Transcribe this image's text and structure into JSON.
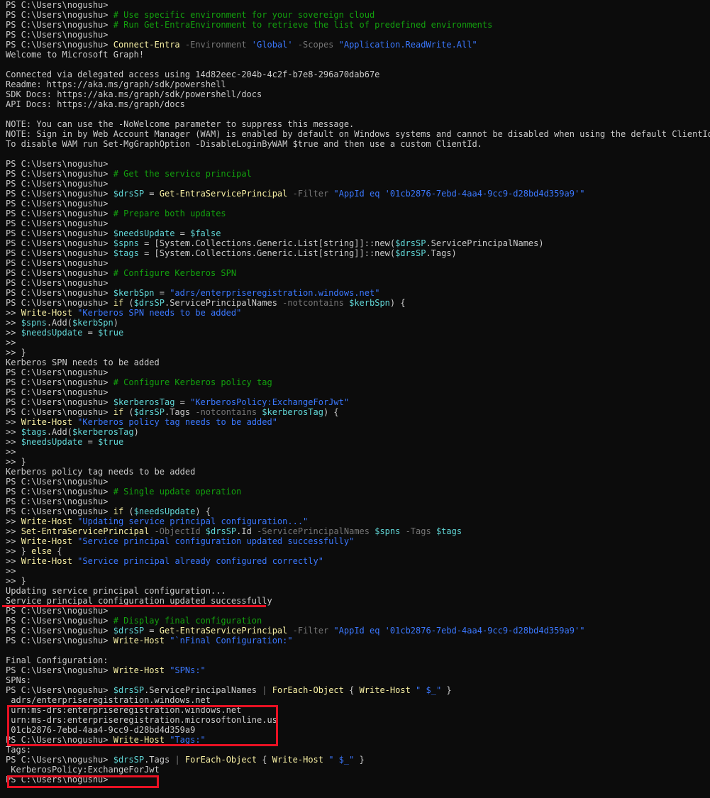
{
  "window": {
    "background": "#0c0c0c",
    "foreground": "#cccccc"
  },
  "colors": {
    "prompt": "#cccccc",
    "comment": "#13a10e",
    "command": "#f9f1a5",
    "variable": "#61d6d6",
    "string": "#3b78ff",
    "parameter": "#767676",
    "annotation": "#e81123"
  },
  "terminal": {
    "lines": [
      [
        [
          "p",
          "PS C:\\Users\\nogushu> "
        ]
      ],
      [
        [
          "p",
          "PS C:\\Users\\nogushu> "
        ],
        [
          "c",
          "# Use specific environment for your sovereign cloud"
        ]
      ],
      [
        [
          "p",
          "PS C:\\Users\\nogushu> "
        ],
        [
          "c",
          "# Run Get-EntraEnvironment to retrieve the list of predefined environments"
        ]
      ],
      [
        [
          "p",
          "PS C:\\Users\\nogushu> "
        ]
      ],
      [
        [
          "p",
          "PS C:\\Users\\nogushu> "
        ],
        [
          "k",
          "Connect-Entra"
        ],
        [
          "a",
          " -Environment "
        ],
        [
          "s",
          "'Global'"
        ],
        [
          "a",
          " -Scopes "
        ],
        [
          "s",
          "\"Application.ReadWrite.All\""
        ]
      ],
      [
        [
          "t",
          "Welcome to Microsoft Graph!"
        ]
      ],
      [
        [
          "t",
          ""
        ]
      ],
      [
        [
          "t",
          "Connected via delegated access using 14d82eec-204b-4c2f-b7e8-296a70dab67e"
        ]
      ],
      [
        [
          "t",
          "Readme: https://aka.ms/graph/sdk/powershell"
        ]
      ],
      [
        [
          "t",
          "SDK Docs: https://aka.ms/graph/sdk/powershell/docs"
        ]
      ],
      [
        [
          "t",
          "API Docs: https://aka.ms/graph/docs"
        ]
      ],
      [
        [
          "t",
          ""
        ]
      ],
      [
        [
          "t",
          "NOTE: You can use the -NoWelcome parameter to suppress this message."
        ]
      ],
      [
        [
          "t",
          "NOTE: Sign in by Web Account Manager (WAM) is enabled by default on Windows systems and cannot be disabled when using the default ClientId."
        ]
      ],
      [
        [
          "t",
          "To disable WAM run Set-MgGraphOption -DisableLoginByWAM $true and then use a custom ClientId."
        ]
      ],
      [
        [
          "t",
          ""
        ]
      ],
      [
        [
          "p",
          "PS C:\\Users\\nogushu> "
        ]
      ],
      [
        [
          "p",
          "PS C:\\Users\\nogushu> "
        ],
        [
          "c",
          "# Get the service principal"
        ]
      ],
      [
        [
          "p",
          "PS C:\\Users\\nogushu> "
        ]
      ],
      [
        [
          "p",
          "PS C:\\Users\\nogushu> "
        ],
        [
          "v",
          "$drsSP"
        ],
        [
          "d",
          " = "
        ],
        [
          "k",
          "Get-EntraServicePrincipal"
        ],
        [
          "a",
          " -Filter "
        ],
        [
          "s",
          "\"AppId eq '01cb2876-7ebd-4aa4-9cc9-d28bd4d359a9'\""
        ]
      ],
      [
        [
          "p",
          "PS C:\\Users\\nogushu> "
        ]
      ],
      [
        [
          "p",
          "PS C:\\Users\\nogushu> "
        ],
        [
          "c",
          "# Prepare both updates"
        ]
      ],
      [
        [
          "p",
          "PS C:\\Users\\nogushu> "
        ]
      ],
      [
        [
          "p",
          "PS C:\\Users\\nogushu> "
        ],
        [
          "v",
          "$needsUpdate"
        ],
        [
          "d",
          " = "
        ],
        [
          "v",
          "$false"
        ]
      ],
      [
        [
          "p",
          "PS C:\\Users\\nogushu> "
        ],
        [
          "v",
          "$spns"
        ],
        [
          "d",
          " = [System.Collections.Generic.List[string]]::new("
        ],
        [
          "v",
          "$drsSP"
        ],
        [
          "d",
          ".ServicePrincipalNames)"
        ]
      ],
      [
        [
          "p",
          "PS C:\\Users\\nogushu> "
        ],
        [
          "v",
          "$tags"
        ],
        [
          "d",
          " = [System.Collections.Generic.List[string]]::new("
        ],
        [
          "v",
          "$drsSP"
        ],
        [
          "d",
          ".Tags)"
        ]
      ],
      [
        [
          "p",
          "PS C:\\Users\\nogushu> "
        ]
      ],
      [
        [
          "p",
          "PS C:\\Users\\nogushu> "
        ],
        [
          "c",
          "# Configure Kerberos SPN"
        ]
      ],
      [
        [
          "p",
          "PS C:\\Users\\nogushu> "
        ]
      ],
      [
        [
          "p",
          "PS C:\\Users\\nogushu> "
        ],
        [
          "v",
          "$kerbSpn"
        ],
        [
          "d",
          " = "
        ],
        [
          "s",
          "\"adrs/enterpriseregistration.windows.net\""
        ]
      ],
      [
        [
          "p",
          "PS C:\\Users\\nogushu> "
        ],
        [
          "k",
          "if"
        ],
        [
          "d",
          " ("
        ],
        [
          "v",
          "$drsSP"
        ],
        [
          "d",
          ".ServicePrincipalNames "
        ],
        [
          "a",
          "-notcontains"
        ],
        [
          "d",
          " "
        ],
        [
          "v",
          "$kerbSpn"
        ],
        [
          "d",
          ") {"
        ]
      ],
      [
        [
          "p",
          ">> "
        ],
        [
          "k",
          "Write-Host"
        ],
        [
          "d",
          " "
        ],
        [
          "s",
          "\"Kerberos SPN needs to be added\""
        ]
      ],
      [
        [
          "p",
          ">> "
        ],
        [
          "v",
          "$spns"
        ],
        [
          "d",
          ".Add("
        ],
        [
          "v",
          "$kerbSpn"
        ],
        [
          "d",
          ")"
        ]
      ],
      [
        [
          "p",
          ">> "
        ],
        [
          "v",
          "$needsUpdate"
        ],
        [
          "d",
          " = "
        ],
        [
          "v",
          "$true"
        ]
      ],
      [
        [
          "p",
          ">> "
        ]
      ],
      [
        [
          "p",
          ">> }"
        ]
      ],
      [
        [
          "t",
          "Kerberos SPN needs to be added"
        ]
      ],
      [
        [
          "p",
          "PS C:\\Users\\nogushu> "
        ]
      ],
      [
        [
          "p",
          "PS C:\\Users\\nogushu> "
        ],
        [
          "c",
          "# Configure Kerberos policy tag"
        ]
      ],
      [
        [
          "p",
          "PS C:\\Users\\nogushu> "
        ]
      ],
      [
        [
          "p",
          "PS C:\\Users\\nogushu> "
        ],
        [
          "v",
          "$kerberosTag"
        ],
        [
          "d",
          " = "
        ],
        [
          "s",
          "\"KerberosPolicy:ExchangeForJwt\""
        ]
      ],
      [
        [
          "p",
          "PS C:\\Users\\nogushu> "
        ],
        [
          "k",
          "if"
        ],
        [
          "d",
          " ("
        ],
        [
          "v",
          "$drsSP"
        ],
        [
          "d",
          ".Tags "
        ],
        [
          "a",
          "-notcontains"
        ],
        [
          "d",
          " "
        ],
        [
          "v",
          "$kerberosTag"
        ],
        [
          "d",
          ") {"
        ]
      ],
      [
        [
          "p",
          ">> "
        ],
        [
          "k",
          "Write-Host"
        ],
        [
          "d",
          " "
        ],
        [
          "s",
          "\"Kerberos policy tag needs to be added\""
        ]
      ],
      [
        [
          "p",
          ">> "
        ],
        [
          "v",
          "$tags"
        ],
        [
          "d",
          ".Add("
        ],
        [
          "v",
          "$kerberosTag"
        ],
        [
          "d",
          ")"
        ]
      ],
      [
        [
          "p",
          ">> "
        ],
        [
          "v",
          "$needsUpdate"
        ],
        [
          "d",
          " = "
        ],
        [
          "v",
          "$true"
        ]
      ],
      [
        [
          "p",
          ">> "
        ]
      ],
      [
        [
          "p",
          ">> }"
        ]
      ],
      [
        [
          "t",
          "Kerberos policy tag needs to be added"
        ]
      ],
      [
        [
          "p",
          "PS C:\\Users\\nogushu> "
        ]
      ],
      [
        [
          "p",
          "PS C:\\Users\\nogushu> "
        ],
        [
          "c",
          "# Single update operation"
        ]
      ],
      [
        [
          "p",
          "PS C:\\Users\\nogushu> "
        ]
      ],
      [
        [
          "p",
          "PS C:\\Users\\nogushu> "
        ],
        [
          "k",
          "if"
        ],
        [
          "d",
          " ("
        ],
        [
          "v",
          "$needsUpdate"
        ],
        [
          "d",
          ") {"
        ]
      ],
      [
        [
          "p",
          ">> "
        ],
        [
          "k",
          "Write-Host"
        ],
        [
          "d",
          " "
        ],
        [
          "s",
          "\"Updating service principal configuration...\""
        ]
      ],
      [
        [
          "p",
          ">> "
        ],
        [
          "k",
          "Set-EntraServicePrincipal"
        ],
        [
          "a",
          " -ObjectId "
        ],
        [
          "v",
          "$drsSP"
        ],
        [
          "d",
          ".Id"
        ],
        [
          "a",
          " -ServicePrincipalNames "
        ],
        [
          "v",
          "$spns"
        ],
        [
          "a",
          " -Tags "
        ],
        [
          "v",
          "$tags"
        ]
      ],
      [
        [
          "p",
          ">> "
        ],
        [
          "k",
          "Write-Host"
        ],
        [
          "d",
          " "
        ],
        [
          "s",
          "\"Service principal configuration updated successfully\""
        ]
      ],
      [
        [
          "p",
          ">> } "
        ],
        [
          "k",
          "else"
        ],
        [
          "d",
          " {"
        ]
      ],
      [
        [
          "p",
          ">> "
        ],
        [
          "k",
          "Write-Host"
        ],
        [
          "d",
          " "
        ],
        [
          "s",
          "\"Service principal already configured correctly\""
        ]
      ],
      [
        [
          "p",
          ">> "
        ]
      ],
      [
        [
          "p",
          ">> }"
        ]
      ],
      [
        [
          "t",
          "Updating service principal configuration..."
        ]
      ],
      [
        [
          "t",
          "Service principal configuration updated successfully"
        ]
      ],
      [
        [
          "p",
          "PS C:\\Users\\nogushu> "
        ]
      ],
      [
        [
          "p",
          "PS C:\\Users\\nogushu> "
        ],
        [
          "c",
          "# Display final configuration"
        ]
      ],
      [
        [
          "p",
          "PS C:\\Users\\nogushu> "
        ],
        [
          "v",
          "$drsSP"
        ],
        [
          "d",
          " = "
        ],
        [
          "k",
          "Get-EntraServicePrincipal"
        ],
        [
          "a",
          " -Filter "
        ],
        [
          "s",
          "\"AppId eq '01cb2876-7ebd-4aa4-9cc9-d28bd4d359a9'\""
        ]
      ],
      [
        [
          "p",
          "PS C:\\Users\\nogushu> "
        ],
        [
          "k",
          "Write-Host"
        ],
        [
          "d",
          " "
        ],
        [
          "s",
          "\"`nFinal Configuration:\""
        ]
      ],
      [
        [
          "t",
          ""
        ]
      ],
      [
        [
          "t",
          "Final Configuration:"
        ]
      ],
      [
        [
          "p",
          "PS C:\\Users\\nogushu> "
        ],
        [
          "k",
          "Write-Host"
        ],
        [
          "d",
          " "
        ],
        [
          "s",
          "\"SPNs:\""
        ]
      ],
      [
        [
          "t",
          "SPNs:"
        ]
      ],
      [
        [
          "p",
          "PS C:\\Users\\nogushu> "
        ],
        [
          "v",
          "$drsSP"
        ],
        [
          "d",
          ".ServicePrincipalNames "
        ],
        [
          "o",
          "|"
        ],
        [
          "d",
          " "
        ],
        [
          "k",
          "ForEach-Object"
        ],
        [
          "d",
          " { "
        ],
        [
          "k",
          "Write-Host"
        ],
        [
          "d",
          " "
        ],
        [
          "s",
          "\" $_\""
        ],
        [
          "d",
          " }"
        ]
      ],
      [
        [
          "t",
          " adrs/enterpriseregistration.windows.net"
        ]
      ],
      [
        [
          "t",
          " urn:ms-drs:enterpriseregistration.windows.net"
        ]
      ],
      [
        [
          "t",
          " urn:ms-drs:enterpriseregistration.microsoftonline.us"
        ]
      ],
      [
        [
          "t",
          " 01cb2876-7ebd-4aa4-9cc9-d28bd4d359a9"
        ]
      ],
      [
        [
          "p",
          "PS C:\\Users\\nogushu> "
        ],
        [
          "k",
          "Write-Host"
        ],
        [
          "d",
          " "
        ],
        [
          "s",
          "\"Tags:\""
        ]
      ],
      [
        [
          "t",
          "Tags:"
        ]
      ],
      [
        [
          "p",
          "PS C:\\Users\\nogushu> "
        ],
        [
          "v",
          "$drsSP"
        ],
        [
          "d",
          ".Tags "
        ],
        [
          "o",
          "|"
        ],
        [
          "d",
          " "
        ],
        [
          "k",
          "ForEach-Object"
        ],
        [
          "d",
          " { "
        ],
        [
          "k",
          "Write-Host"
        ],
        [
          "d",
          " "
        ],
        [
          "s",
          "\" $_\""
        ],
        [
          "d",
          " }"
        ]
      ],
      [
        [
          "t",
          " KerberosPolicy:ExchangeForJwt"
        ]
      ],
      [
        [
          "p",
          "PS C:\\Users\\nogushu> "
        ]
      ]
    ]
  }
}
